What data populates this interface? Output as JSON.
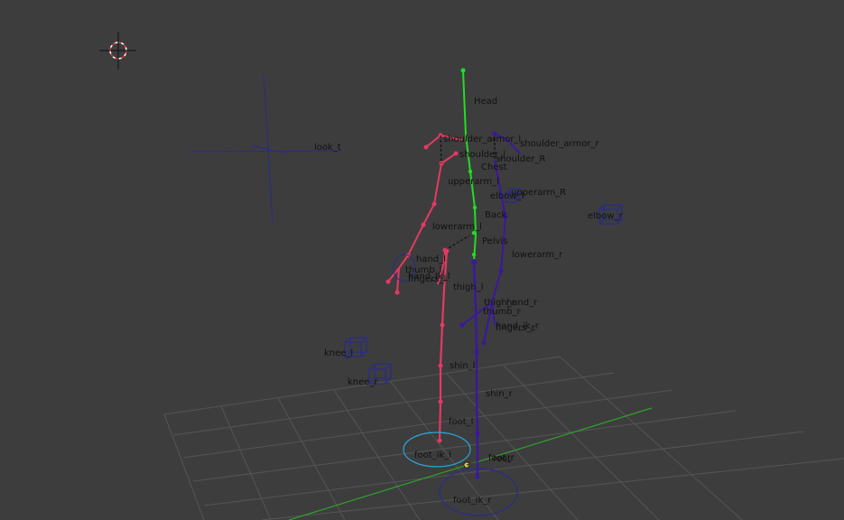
{
  "viewport": {
    "background": "#3d3d3d",
    "grid_color": "#555555",
    "x_axis_color": "#2fa02f",
    "left_chain_color": "#e33a64",
    "right_chain_color": "#3a17a0",
    "spine_color": "#22dd22",
    "control_color": "#2a2a8c",
    "ik_left_color": "#2aa7d6",
    "cursor_icon": "3d-cursor-icon",
    "bones": {
      "head": "Head",
      "shoulder_armor_l": "shoulder_armor_l",
      "shoulder_armor_r": "shoulder_armor_r",
      "shoulder_l": "shoulder_l",
      "shoulder_r": "shoulder_R",
      "chest": "Chest",
      "upperarm_l": "upperarm_l",
      "upperarm_r": "upperarm_R",
      "elbow_l": "elbow_l",
      "elbow_r": "elbow_r",
      "back": "Back",
      "lowerarm_l": "lowerarm_l",
      "lowerarm_r": "lowerarm_r",
      "pelvis": "Pelvis",
      "hand_l": "hand_l",
      "thumb_l": "thumb_l",
      "hand_ik_l": "hand_ik_l",
      "fingers_l": "fingers_l",
      "thigh_l": "thigh_l",
      "thigh_r": "thigh_r",
      "hand_r": "hand_r",
      "thumb_r": "thumb_r",
      "hand_ik_r": "hand_ik_r",
      "fingers_r": "fingers_r",
      "knee_l": "knee_l",
      "knee_r": "knee_r",
      "shin_l": "shin_l",
      "shin_r": "shin_r",
      "foot_l": "foot_l",
      "foot_ik_l": "foot_ik_l",
      "foot_r": "foot_r",
      "root": "root",
      "foot_ik_r": "foot_ik_r",
      "look_t": "look_t"
    }
  }
}
